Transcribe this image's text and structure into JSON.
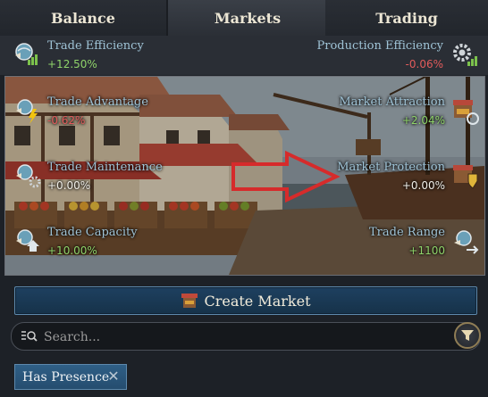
{
  "tabs": [
    {
      "label": "Balance"
    },
    {
      "label": "Markets"
    },
    {
      "label": "Trading"
    }
  ],
  "efficiency": {
    "trade": {
      "label": "Trade Efficiency",
      "value": "+12.50%"
    },
    "production": {
      "label": "Production Efficiency",
      "value": "-0.06%"
    }
  },
  "stats": {
    "trade_advantage": {
      "label": "Trade Advantage",
      "value": "-0.62%"
    },
    "market_attraction": {
      "label": "Market Attraction",
      "value": "+2.04%"
    },
    "trade_maintenance": {
      "label": "Trade Maintenance",
      "value": "+0.00%"
    },
    "market_protection": {
      "label": "Market Protection",
      "value": "+0.00%"
    },
    "trade_capacity": {
      "label": "Trade Capacity",
      "value": "+10.00%"
    },
    "trade_range": {
      "label": "Trade Range",
      "value": "+1100"
    }
  },
  "create_market": {
    "label": "Create Market"
  },
  "search": {
    "placeholder": "Search..."
  },
  "filter_chip": {
    "label": "Has Presence"
  },
  "icons": {
    "search": "search-list-icon",
    "filter": "funnel-icon",
    "chip_close": "close-icon",
    "create": "market-stall-icon"
  },
  "colors": {
    "positive": "#8fd36a",
    "negative": "#e25b5b",
    "label": "#9fc3d6",
    "accent_button": "#1e4060",
    "highlight_arrow": "#d62b2b"
  }
}
